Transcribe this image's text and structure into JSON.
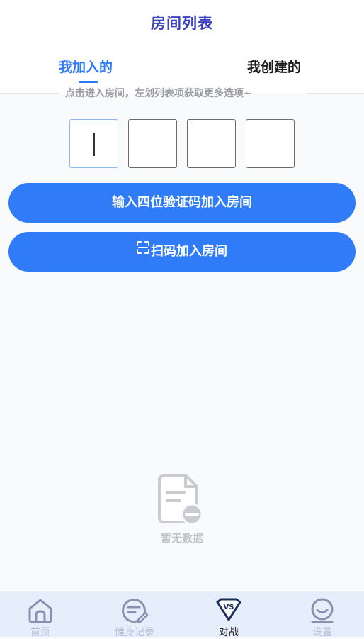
{
  "header": {
    "title": "房间列表"
  },
  "tabs": {
    "joined_label": "我加入的",
    "created_label": "我创建的",
    "active": "joined"
  },
  "hint": {
    "text": "点击进入房间，左划列表项获取更多选项~"
  },
  "code_input": {
    "digits": [
      "",
      "",
      "",
      ""
    ]
  },
  "buttons": {
    "join_by_code_label": "输入四位验证码加入房间",
    "scan_label": "扫码加入房间"
  },
  "empty_state": {
    "icon": "document-remove-icon",
    "text": "暂无数据"
  },
  "tabbar": {
    "items": [
      {
        "label": "首页",
        "icon": "home-icon",
        "active": false
      },
      {
        "label": "健身记录",
        "icon": "fitness-record-icon",
        "active": false
      },
      {
        "label": "对战",
        "icon": "vs-icon",
        "active": true
      },
      {
        "label": "设置",
        "icon": "settings-face-icon",
        "active": false
      }
    ]
  },
  "colors": {
    "accent": "#2f7bf8",
    "title": "#3b40c4",
    "tabbar_bg": "#e6edfb"
  }
}
